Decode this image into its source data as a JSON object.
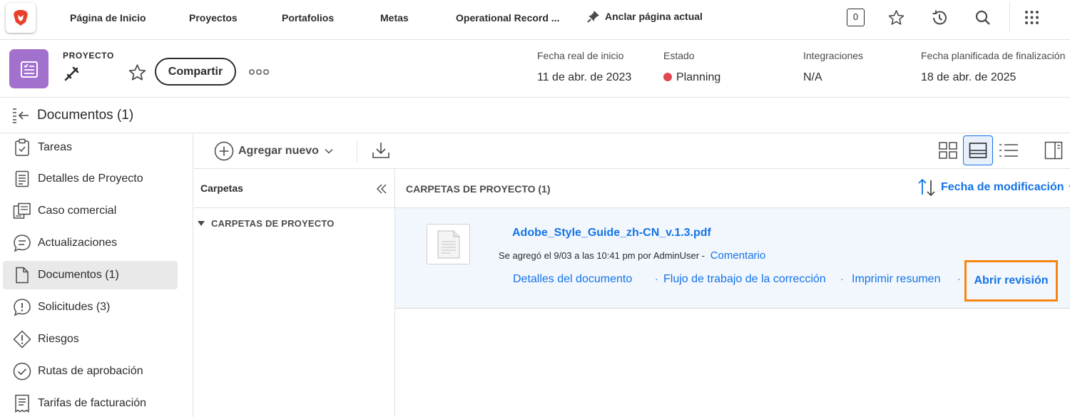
{
  "topnav": {
    "items": [
      "Página de Inicio",
      "Proyectos",
      "Portafolios",
      "Metas",
      "Operational Record ..."
    ],
    "pin_label": "Anclar página actual",
    "counter": "0"
  },
  "project": {
    "type_label": "PROYECTO",
    "share_label": "Compartir",
    "meta": [
      {
        "label": "Fecha real de inicio",
        "value": "11 de abr. de 2023"
      },
      {
        "label": "Estado",
        "value": "Planning"
      },
      {
        "label": "Integraciones",
        "value": "N/A"
      },
      {
        "label": "Fecha planificada de finalización",
        "value": "18 de abr. de 2025"
      }
    ],
    "status_color": "#e34850"
  },
  "docbar": {
    "title": "Documentos (1)"
  },
  "sidebar": {
    "items": [
      {
        "label": "Tareas",
        "icon": "clipboard-check-icon"
      },
      {
        "label": "Detalles de Proyecto",
        "icon": "document-lines-icon"
      },
      {
        "label": "Caso comercial",
        "icon": "business-case-icon"
      },
      {
        "label": "Actualizaciones",
        "icon": "comment-icon"
      },
      {
        "label": "Documentos (1)",
        "icon": "document-icon"
      },
      {
        "label": "Solicitudes (3)",
        "icon": "alert-bubble-icon"
      },
      {
        "label": "Riesgos",
        "icon": "alert-diamond-icon"
      },
      {
        "label": "Rutas de aprobación",
        "icon": "checkmark-circle-icon"
      },
      {
        "label": "Tarifas de facturación",
        "icon": "receipt-icon"
      }
    ]
  },
  "toolbar": {
    "add_new": "Agregar nuevo"
  },
  "folders": {
    "title": "Carpetas",
    "group": "CARPETAS DE PROYECTO"
  },
  "content": {
    "title": "CARPETAS DE PROYECTO (1)",
    "sort_label": "Fecha de modificación",
    "document": {
      "name": "Adobe_Style_Guide_zh-CN_v.1.3.pdf",
      "added": "Se agregó el 9/03 a las 10:41 pm por AdminUser -",
      "comment": "Comentario",
      "links": [
        "Detalles del documento",
        "Flujo de trabajo de la corrección",
        "Imprimir resumen"
      ],
      "open_review": "Abrir revisión"
    }
  },
  "colors": {
    "accent": "#1473e6",
    "highlight": "#f68511",
    "project_icon": "#a271ce"
  }
}
